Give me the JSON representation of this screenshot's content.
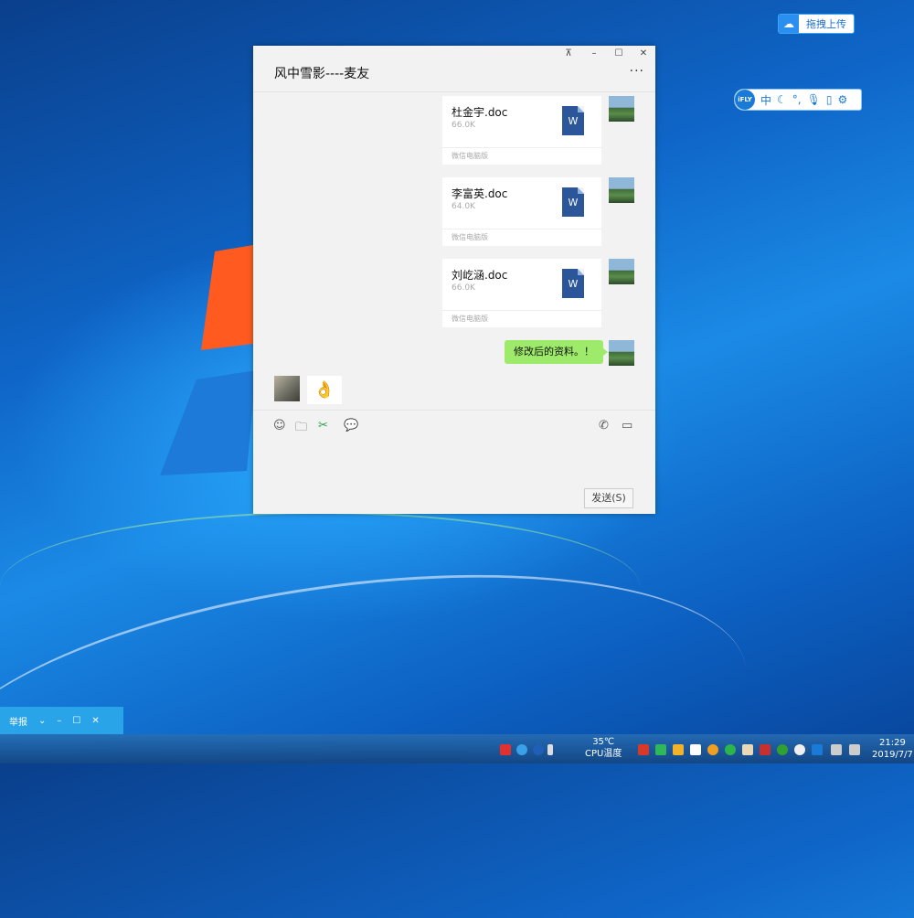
{
  "desktop": {
    "baidu_upload_label": "拖拽上传",
    "ime": {
      "brand": "iFLY",
      "mode": "中"
    }
  },
  "chat": {
    "title": "风中雪影----麦友",
    "controls": {
      "pin": "⊼",
      "minimize": "–",
      "maximize": "☐",
      "close": "✕",
      "more": "···"
    },
    "files": [
      {
        "name": "杜金宇.doc",
        "size": "66.0K",
        "source": "微信电脑版",
        "doc_letter": "W"
      },
      {
        "name": "李富英.doc",
        "size": "64.0K",
        "source": "微信电脑版",
        "doc_letter": "W"
      },
      {
        "name": "刘屹涵.doc",
        "size": "66.0K",
        "source": "微信电脑版",
        "doc_letter": "W"
      }
    ],
    "text_message": "修改后的资料。！",
    "sticker": "👌",
    "toolbar": {
      "emoji": "☺",
      "folder": "🗀",
      "scissors": "✂",
      "chat_history": "💬",
      "phone": "✆",
      "video": "▭"
    },
    "send_label": "发送(S)"
  },
  "mini_panel": {
    "label": "举报",
    "chevron": "⌄",
    "minimize": "–",
    "maximize": "☐",
    "close": "✕"
  },
  "taskbar": {
    "temperature": "35℃",
    "temperature_label": "CPU温度",
    "time": "21:29",
    "date": "2019/7/7"
  }
}
